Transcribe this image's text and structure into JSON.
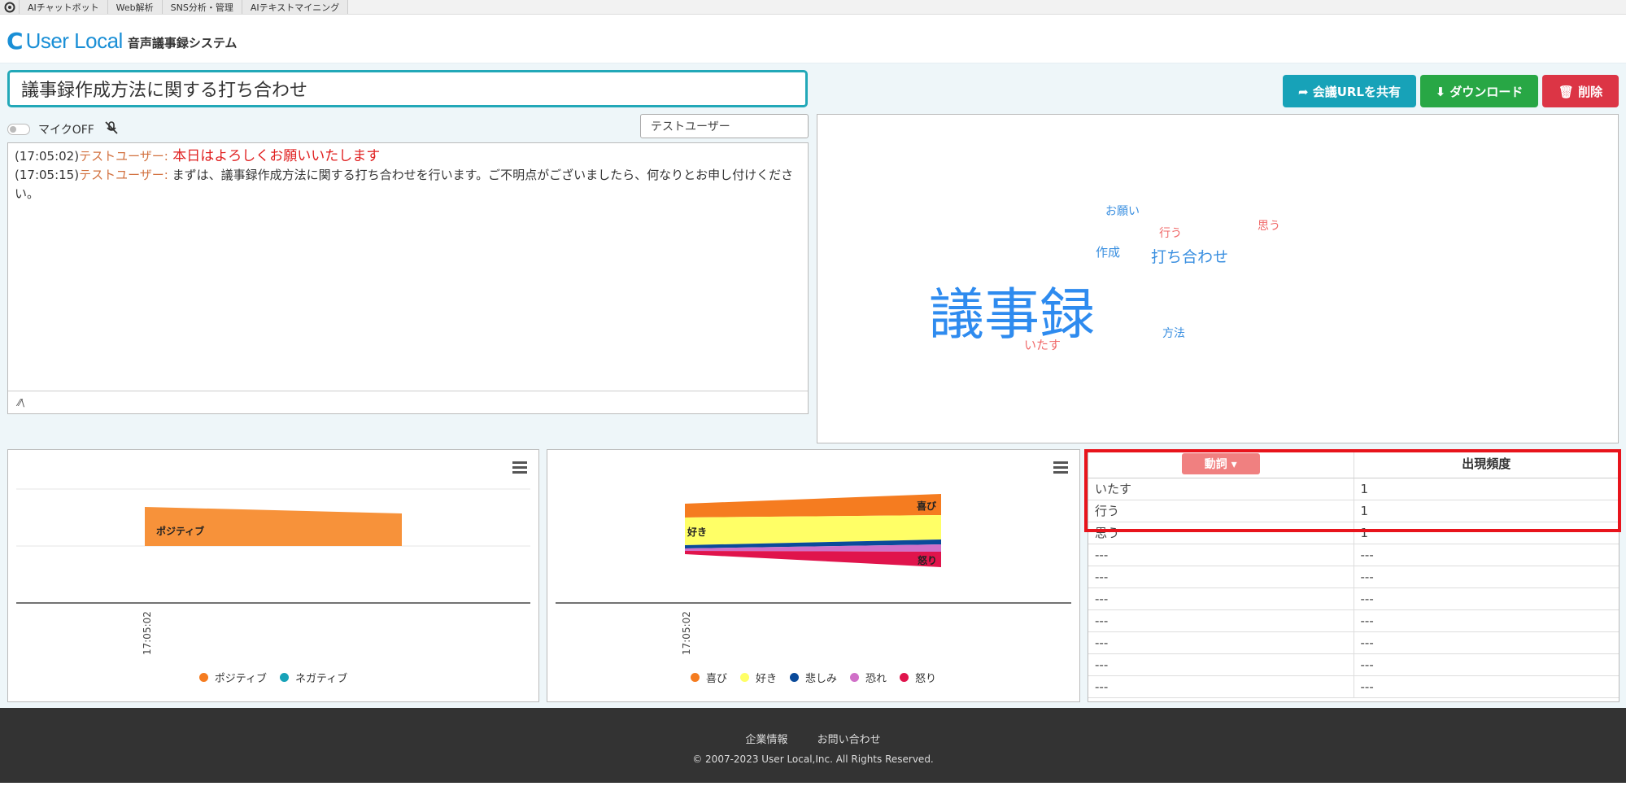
{
  "top_tabs": [
    "AIチャットボット",
    "Web解析",
    "SNS分析・管理",
    "AIテキストマイニング"
  ],
  "brand": {
    "mark": "C",
    "name": "User Local",
    "subtitle": "音声議事録システム"
  },
  "meeting": {
    "title": "議事録作成方法に関する打ち合わせ"
  },
  "buttons": {
    "share": "➦ 会議URLを共有",
    "download": "⬇ ダウンロード",
    "delete": "🗑 削除"
  },
  "mic": {
    "label": "マイクOFF",
    "icon": "mic-off-icon"
  },
  "user_select": {
    "value": "テストユーザー"
  },
  "transcript": [
    {
      "time": "(17:05:02)",
      "speaker": "テストユーザー:",
      "text": " 本日はよろしくお願いいたします"
    },
    {
      "time": "(17:05:15)",
      "speaker": "テストユーザー:",
      "text": " まずは、議事録作成方法に関する打ち合わせを行います。ご不明点がございましたら、何なりとお申し付けください。"
    }
  ],
  "resize_handle": "⁄⁄\\",
  "word_cloud": [
    {
      "word": "お願い",
      "color": "#3a8fe0"
    },
    {
      "word": "行う",
      "color": "#f06a6a"
    },
    {
      "word": "思う",
      "color": "#f06a6a"
    },
    {
      "word": "作成",
      "color": "#3a8fe0"
    },
    {
      "word": "打ち合わせ",
      "color": "#3a8fe0"
    },
    {
      "word": "議事録",
      "color": "#2e8bef"
    },
    {
      "word": "方法",
      "color": "#3a8fe0"
    },
    {
      "word": "いたす",
      "color": "#f06a6a"
    }
  ],
  "sentiment_chart": {
    "legend": [
      {
        "name": "ポジティブ",
        "color": "#f57c20"
      },
      {
        "name": "ネガティブ",
        "color": "#17a2b8"
      }
    ],
    "band_label": "ポジティブ",
    "x_label": "17:05:02"
  },
  "emotion_chart": {
    "legend": [
      {
        "name": "喜び",
        "color": "#f57c20"
      },
      {
        "name": "好き",
        "color": "#ffff66"
      },
      {
        "name": "悲しみ",
        "color": "#0a4a9a"
      },
      {
        "name": "恐れ",
        "color": "#d070c8"
      },
      {
        "name": "怒り",
        "color": "#e0144c"
      }
    ],
    "labels": {
      "joy": "喜び",
      "like": "好き",
      "anger": "怒り"
    },
    "x_label": "17:05:02"
  },
  "freq_table": {
    "header_left": "動詞 ▾",
    "header_right": "出現頻度",
    "rows": [
      [
        "いたす",
        "1"
      ],
      [
        "行う",
        "1"
      ],
      [
        "思う",
        "1"
      ],
      [
        "---",
        "---"
      ],
      [
        "---",
        "---"
      ],
      [
        "---",
        "---"
      ],
      [
        "---",
        "---"
      ],
      [
        "---",
        "---"
      ],
      [
        "---",
        "---"
      ],
      [
        "---",
        "---"
      ]
    ]
  },
  "footer": {
    "links": [
      "企業情報",
      "お問い合わせ"
    ],
    "copyright": "© 2007-2023 User Local,Inc. All Rights Reserved."
  }
}
